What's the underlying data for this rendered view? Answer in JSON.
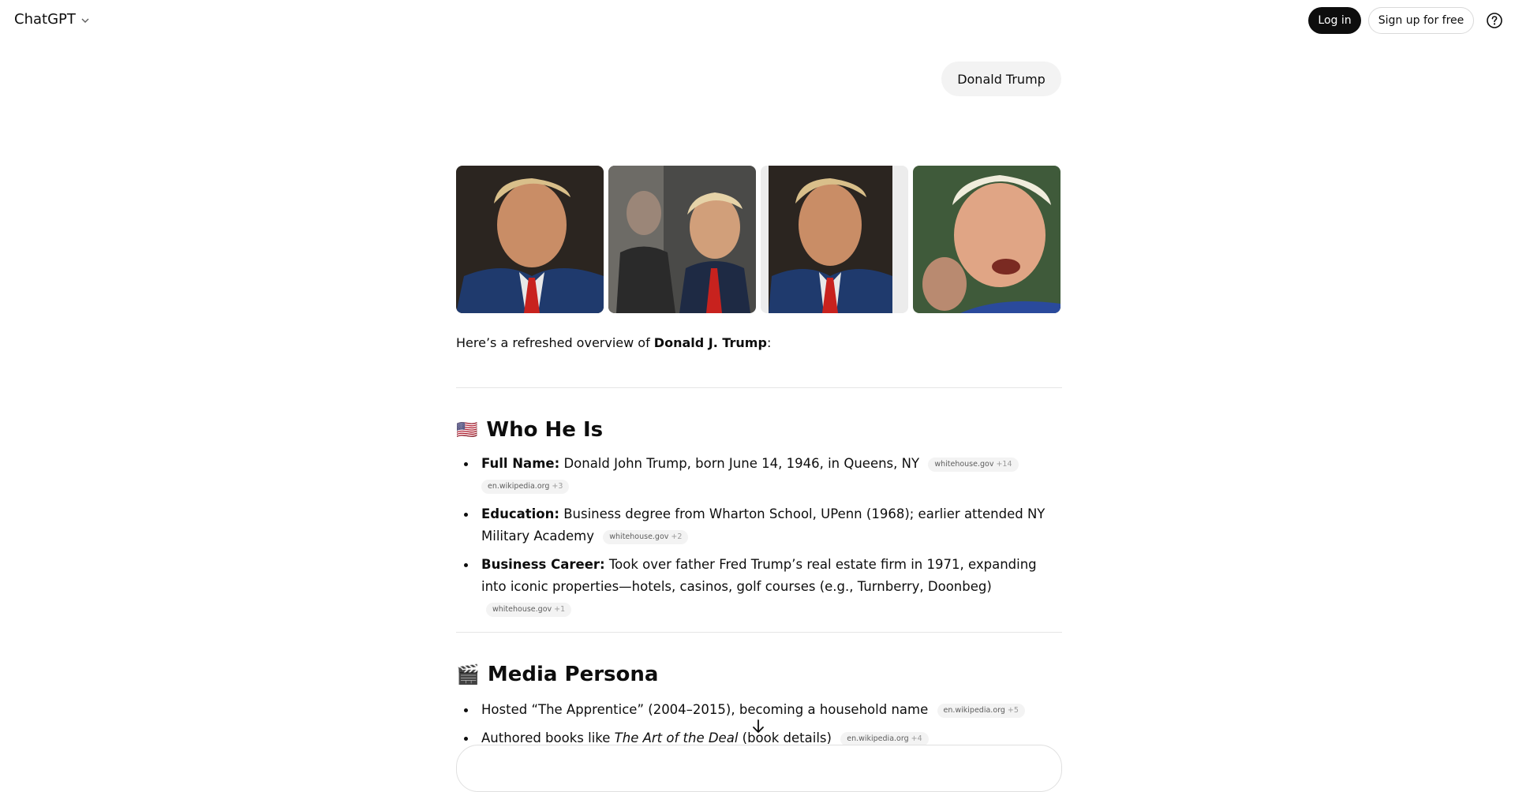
{
  "header": {
    "app_title": "ChatGPT",
    "login_label": "Log in",
    "signup_label": "Sign up for free",
    "help_icon": "help-circle-icon"
  },
  "user_message": "Donald Trump",
  "images": [
    {
      "alt_icon": "portrait-photo"
    },
    {
      "alt_icon": "event-photo"
    },
    {
      "alt_icon": "portrait-photo"
    },
    {
      "alt_icon": "speaking-photo"
    }
  ],
  "answer": {
    "intro_pre": "Here’s a refreshed overview of ",
    "intro_bold": "Donald J. Trump",
    "intro_post": ":",
    "sections": [
      {
        "icon": "🇺🇸",
        "title": "Who He Is",
        "items": [
          {
            "label": "Full Name:",
            "text": "Donald John Trump, born June 14, 1946, in Queens, NY",
            "cites": [
              {
                "source": "whitehouse.gov",
                "more": "+14"
              },
              {
                "source": "en.wikipedia.org",
                "more": "+3"
              }
            ]
          },
          {
            "label": "Education:",
            "text": "Business degree from Wharton School, UPenn (1968); earlier attended NY Military Academy",
            "cites": [
              {
                "source": "whitehouse.gov",
                "more": "+2"
              }
            ]
          },
          {
            "label": "Business Career:",
            "text": "Took over father Fred Trump’s real estate firm in 1971, expanding into iconic properties—hotels, casinos, golf courses (e.g., Turnberry, Doonbeg)",
            "cites": [
              {
                "source": "whitehouse.gov",
                "more": "+1"
              }
            ]
          }
        ]
      },
      {
        "icon": "🎬",
        "title": "Media Persona",
        "items": [
          {
            "text": "Hosted “The Apprentice” (2004–2015), becoming a household name",
            "cites": [
              {
                "source": "en.wikipedia.org",
                "more": "+5"
              }
            ]
          },
          {
            "text_pre": "Authored books like ",
            "text_italic": "The Art of the Deal",
            "text_post": " (book details)",
            "cites": [
              {
                "source": "en.wikipedia.org",
                "more": "+4"
              }
            ]
          }
        ]
      }
    ]
  }
}
